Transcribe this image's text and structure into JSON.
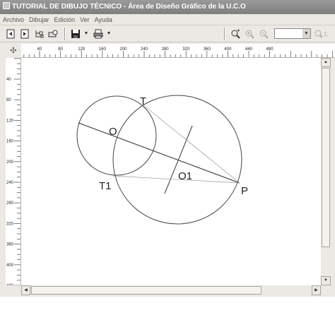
{
  "window": {
    "title": "TUTORIAL DE DIBUJO TÉCNICO - Área de Diseño Gráfico de la U.C.O"
  },
  "menu": [
    "Archivo",
    "Dibujar",
    "Edición",
    "Ver",
    "Ayuda"
  ],
  "toolbar": {
    "left_icons": [
      "back-page-icon",
      "forward-page-icon",
      "tree-icon",
      "print-preview-icon",
      "save-icon",
      "print-icon"
    ],
    "right_icons": [
      "zoom-fit-icon",
      "zoom-in-icon",
      "zoom-out-icon",
      "zoom-one-icon"
    ],
    "zoom_value": "",
    "zoom_one_label": "1:"
  },
  "ruler": {
    "top_labels": [
      "40",
      "80",
      "120",
      "160",
      "200",
      "240",
      "280",
      "320",
      "360",
      "400",
      "440",
      "480"
    ],
    "left_labels": [
      "40",
      "80",
      "120",
      "160",
      "200",
      "240",
      "280",
      "320",
      "360",
      "400",
      "440"
    ]
  },
  "drawing": {
    "labels": {
      "T": "T",
      "O": "O",
      "T1": "T1",
      "O1": "O1",
      "P": "P"
    }
  }
}
